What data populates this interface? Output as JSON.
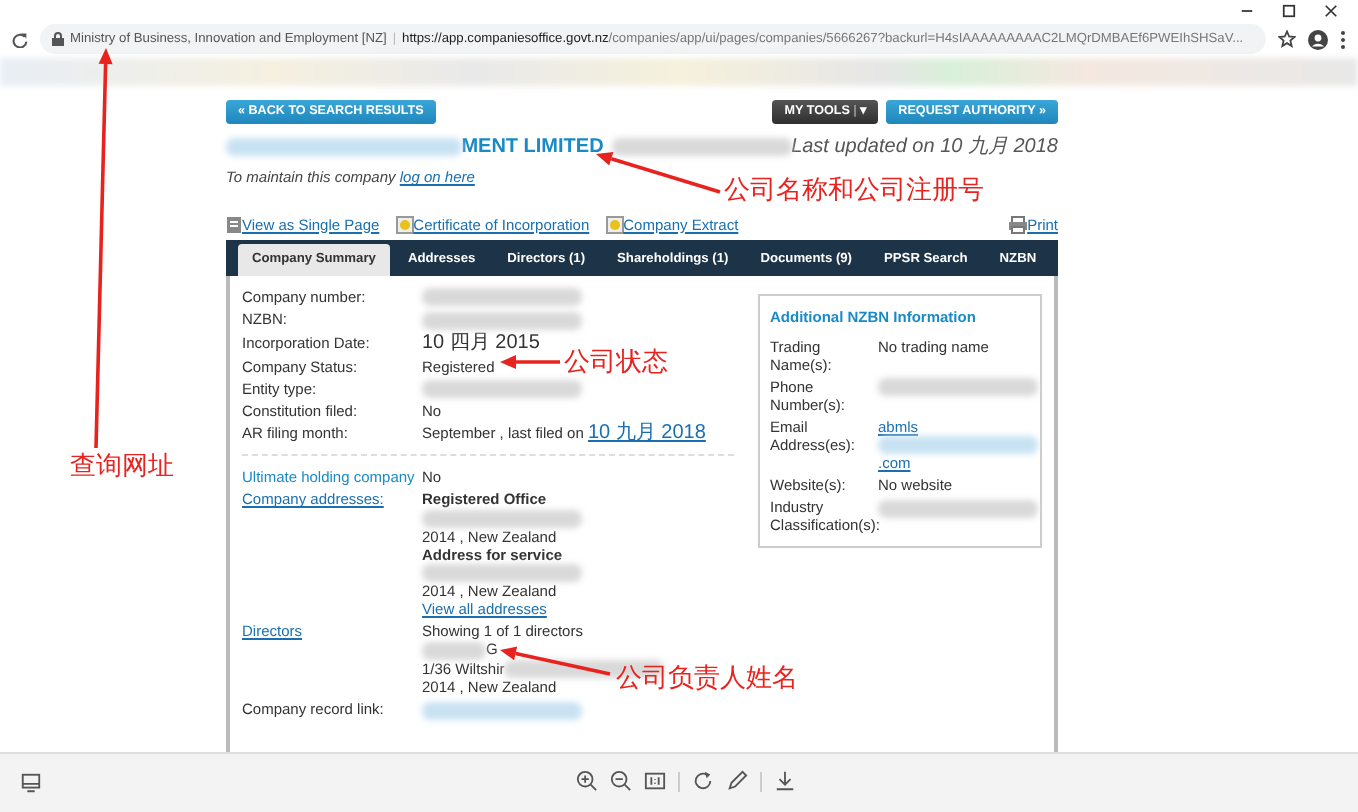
{
  "address_bar": {
    "site_name": "Ministry of Business, Innovation and Employment [NZ]",
    "url_host": "https://app.companiesoffice.govt.nz",
    "url_path": "/companies/app/ui/pages/companies/5666267?backurl=H4sIAAAAAAAAAC2LMQrDMBAEf6PWEIhSHSaV...",
    "separator": "|"
  },
  "toolbar": {
    "back_button": "« BACK TO SEARCH RESULTS",
    "tools_button": "MY TOOLS",
    "tools_separator": "|",
    "tools_caret": "▾",
    "authority_button": "REQUEST AUTHORITY »"
  },
  "company": {
    "name_visible": "MENT LIMITED",
    "last_updated": "Last updated on 10 九月 2018",
    "maintain_text": "To maintain this company",
    "maintain_link": "log on here"
  },
  "doc_links": [
    {
      "label": "View as Single Page",
      "kind": "page"
    },
    {
      "label": "Certificate of Incorporation",
      "kind": "certificate"
    },
    {
      "label": "Company Extract",
      "kind": "certificate"
    }
  ],
  "print_link": "Print",
  "tabs": [
    {
      "label": "Company Summary",
      "selected": true
    },
    {
      "label": "Addresses",
      "selected": false
    },
    {
      "label": "Directors (1)",
      "selected": false
    },
    {
      "label": "Shareholdings (1)",
      "selected": false
    },
    {
      "label": "Documents (9)",
      "selected": false
    },
    {
      "label": "PPSR Search",
      "selected": false
    },
    {
      "label": "NZBN",
      "selected": false
    }
  ],
  "summary_rows": [
    {
      "label": "Company number:",
      "kind": "plain",
      "lines": [
        {
          "kind": "redacted"
        }
      ]
    },
    {
      "label": "NZBN:",
      "kind": "plain",
      "lines": [
        {
          "kind": "redacted"
        }
      ]
    },
    {
      "label": "Incorporation Date:",
      "kind": "plain",
      "lines": [
        {
          "kind": "date",
          "text": "10 四月 2015"
        }
      ]
    },
    {
      "label": "Company Status:",
      "kind": "plain",
      "lines": [
        {
          "kind": "text",
          "text": "Registered"
        }
      ]
    },
    {
      "label": "Entity type:",
      "kind": "plain",
      "lines": [
        {
          "kind": "redacted"
        }
      ]
    },
    {
      "label": "Constitution filed:",
      "kind": "plain",
      "lines": [
        {
          "kind": "text",
          "text": "No"
        }
      ]
    },
    {
      "label": "AR filing month:",
      "kind": "plain",
      "lines": [
        {
          "kind": "text-link",
          "text": "September , last filed on",
          "link": "10 九月 2018"
        }
      ]
    }
  ],
  "detail_rows": [
    {
      "label": "Ultimate holding company",
      "kind": "link",
      "lines": [
        {
          "kind": "text",
          "text": "No"
        }
      ]
    },
    {
      "label": "Company addresses:",
      "kind": "underlined-link",
      "lines": [
        {
          "kind": "bold",
          "text": "Registered Office"
        },
        {
          "kind": "redacted"
        },
        {
          "kind": "text",
          "text": "2014 , New Zealand"
        },
        {
          "kind": "bold",
          "text": "Address for service"
        },
        {
          "kind": "redacted"
        },
        {
          "kind": "text",
          "text": "2014 , New Zealand"
        },
        {
          "kind": "link",
          "text": "View all addresses"
        }
      ]
    },
    {
      "label": "Directors",
      "kind": "underlined-link",
      "lines": [
        {
          "kind": "text",
          "text": "Showing 1 of 1 directors"
        },
        {
          "kind": "redacted",
          "suffix": "G"
        },
        {
          "kind": "redacted",
          "prefix": "1/36 Wiltshir"
        },
        {
          "kind": "text",
          "text": "2014 , New Zealand"
        }
      ]
    },
    {
      "label": "Company record link:",
      "kind": "plain",
      "lines": [
        {
          "kind": "redacted-link"
        }
      ]
    }
  ],
  "nzbn_info": {
    "title": "Additional NZBN Information",
    "rows": [
      {
        "label": "Trading Name(s):",
        "lines": [
          {
            "kind": "text",
            "text": "No trading name"
          }
        ]
      },
      {
        "label": "Phone Number(s):",
        "lines": [
          {
            "kind": "redacted"
          }
        ]
      },
      {
        "label": "Email Address(es):",
        "lines": [
          {
            "kind": "redacted-link",
            "prefix": "abmls",
            "suffix": ".com"
          }
        ]
      },
      {
        "label": "Website(s):",
        "lines": [
          {
            "kind": "text",
            "text": "No website"
          }
        ]
      },
      {
        "label": "Industry Classification(s):",
        "lines": [
          {
            "kind": "redacted"
          }
        ]
      }
    ]
  },
  "annotations": [
    {
      "text": "查询网址"
    },
    {
      "text": "公司名称和公司注册号"
    },
    {
      "text": "公司状态"
    },
    {
      "text": "公司负责人姓名"
    }
  ]
}
